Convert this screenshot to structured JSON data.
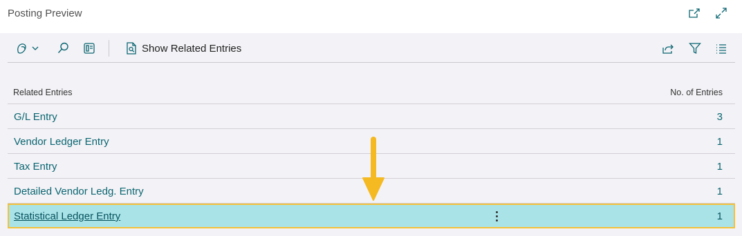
{
  "page": {
    "title": "Posting Preview"
  },
  "toolbar": {
    "show_related_label": "Show Related Entries"
  },
  "grid": {
    "columns": [
      "Related Entries",
      "No. of Entries"
    ],
    "rows": [
      {
        "name": "G/L Entry",
        "count": "3"
      },
      {
        "name": "Vendor Ledger Entry",
        "count": "1"
      },
      {
        "name": "Tax Entry",
        "count": "1"
      },
      {
        "name": "Detailed Vendor Ledg. Entry",
        "count": "1"
      },
      {
        "name": "Statistical Ledger Entry",
        "count": "1",
        "selected": true
      }
    ]
  },
  "colors": {
    "accent": "#0a6672",
    "selected_row": "#a9e3e8",
    "highlight_border": "#f5c13a",
    "arrow": "#f5b921"
  },
  "icons": {
    "header": [
      "open-in-new-window-icon",
      "expand-icon"
    ],
    "toolbar_left": [
      "copilot-icon",
      "chevron-down-icon",
      "search-icon",
      "layout-icon",
      "document-search-icon"
    ],
    "toolbar_right": [
      "share-icon",
      "filter-icon",
      "list-view-icon"
    ],
    "annotation": "down-arrow-icon"
  }
}
